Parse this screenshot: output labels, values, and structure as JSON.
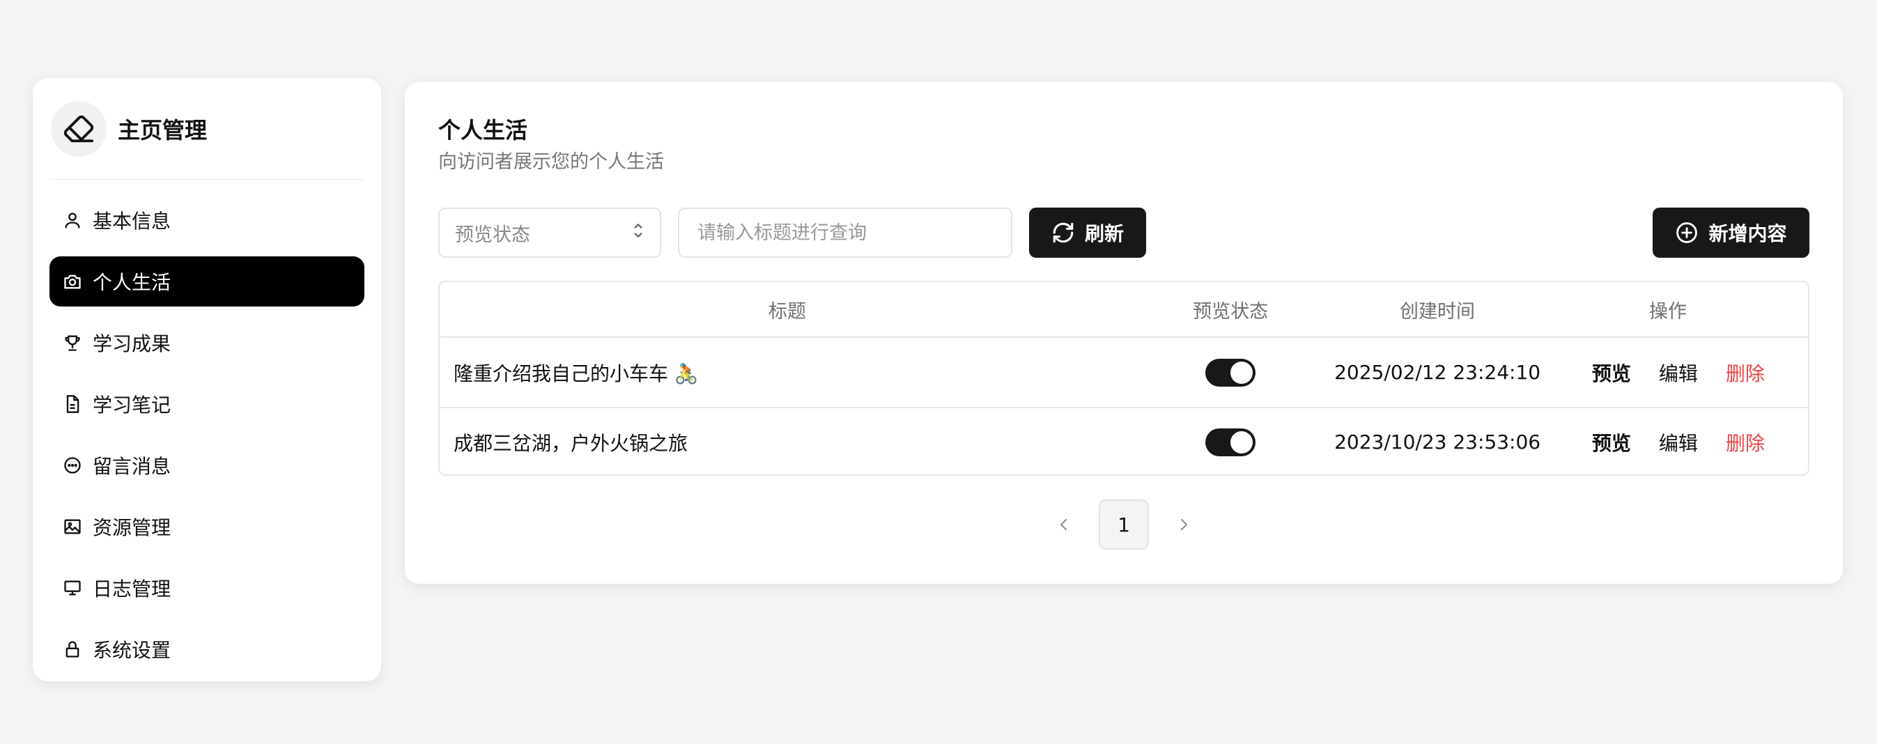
{
  "sidebar": {
    "brand_title": "主页管理",
    "brand_icon": "eraser-icon",
    "items": [
      {
        "label": "基本信息",
        "icon": "user-icon"
      },
      {
        "label": "个人生活",
        "icon": "camera-icon",
        "active": true
      },
      {
        "label": "学习成果",
        "icon": "trophy-icon"
      },
      {
        "label": "学习笔记",
        "icon": "file-text-icon"
      },
      {
        "label": "留言消息",
        "icon": "message-icon"
      },
      {
        "label": "资源管理",
        "icon": "image-icon"
      },
      {
        "label": "日志管理",
        "icon": "monitor-icon"
      },
      {
        "label": "系统设置",
        "icon": "lock-icon"
      }
    ]
  },
  "main": {
    "title": "个人生活",
    "subtitle": "向访问者展示您的个人生活",
    "filter": {
      "placeholder": "预览状态"
    },
    "search": {
      "placeholder": "请输入标题进行查询"
    },
    "refresh_label": "刷新",
    "add_label": "新增内容",
    "table": {
      "headers": {
        "title": "标题",
        "status": "预览状态",
        "time": "创建时间",
        "ops": "操作"
      },
      "rows": [
        {
          "title": "隆重介绍我自己的小车车 🚴",
          "status": true,
          "time": "2025/02/12 23:24:10",
          "preview": "预览",
          "edit": "编辑",
          "delete": "删除"
        },
        {
          "title": "成都三岔湖，户外火锅之旅",
          "status": true,
          "time": "2023/10/23 23:53:06",
          "preview": "预览",
          "edit": "编辑",
          "delete": "删除"
        }
      ]
    },
    "pagination": {
      "current": "1"
    }
  },
  "colors": {
    "accent": "#18181b",
    "danger": "#ef4444",
    "background": "#f4f4f6"
  }
}
